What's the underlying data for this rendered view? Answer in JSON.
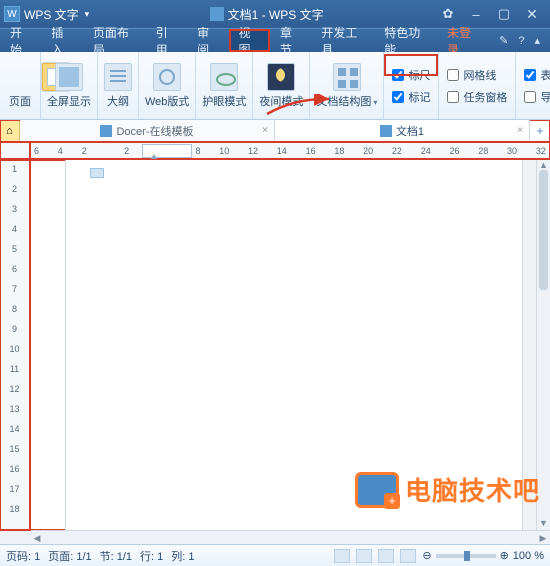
{
  "title": {
    "app_name": "WPS 文字",
    "doc_title": "文档1 - WPS 文字"
  },
  "menu": {
    "items": [
      "开始",
      "插入",
      "页面布局",
      "引用",
      "审阅",
      "视图",
      "章节",
      "开发工具",
      "特色功能"
    ],
    "active_index": 5,
    "not_logged": "未登录"
  },
  "ribbon": {
    "groups": [
      {
        "label": "页面",
        "icon": "page",
        "selected": true
      },
      {
        "label": "全屏显示",
        "icon": "full"
      },
      {
        "label": "大纲",
        "icon": "outline"
      },
      {
        "label": "Web版式",
        "icon": "web"
      },
      {
        "label": "护眼模式",
        "icon": "eye"
      },
      {
        "label": "夜间模式",
        "icon": "moon"
      },
      {
        "label": "文档结构图",
        "icon": "struct",
        "dropdown": true
      }
    ],
    "checks1": [
      {
        "label": "标尺",
        "checked": true
      },
      {
        "label": "标记",
        "checked": true
      }
    ],
    "checks2": [
      {
        "label": "网格线",
        "checked": false
      },
      {
        "label": "任务窗格",
        "checked": false
      }
    ],
    "checks3": [
      {
        "label": "表格虚框",
        "checked": true
      },
      {
        "label": "导航窗格",
        "checked": false
      }
    ],
    "truncated": "显"
  },
  "tabs": {
    "items": [
      {
        "label": "Docer-在线模板",
        "active": false
      },
      {
        "label": "文档1",
        "active": true
      }
    ]
  },
  "hruler": {
    "ticks": [
      "6",
      "4",
      "2",
      "",
      "2",
      "4",
      "6",
      "8",
      "10",
      "12",
      "14",
      "16",
      "18",
      "20",
      "22",
      "24",
      "26",
      "28",
      "30"
    ],
    "tail": "32"
  },
  "vruler": {
    "ticks": [
      "",
      "1",
      "2",
      "3",
      "4",
      "5",
      "6",
      "7",
      "8",
      "9",
      "10",
      "11",
      "12",
      "13",
      "14",
      "15",
      "16",
      "17",
      "18",
      ""
    ]
  },
  "status": {
    "page_no": "页码: 1",
    "page": "页面: 1/1",
    "section": "节: 1/1",
    "line": "行: 1",
    "col": "列: 1",
    "zoom": "100 %"
  },
  "watermark": "电脑技术吧",
  "chart_data": null
}
